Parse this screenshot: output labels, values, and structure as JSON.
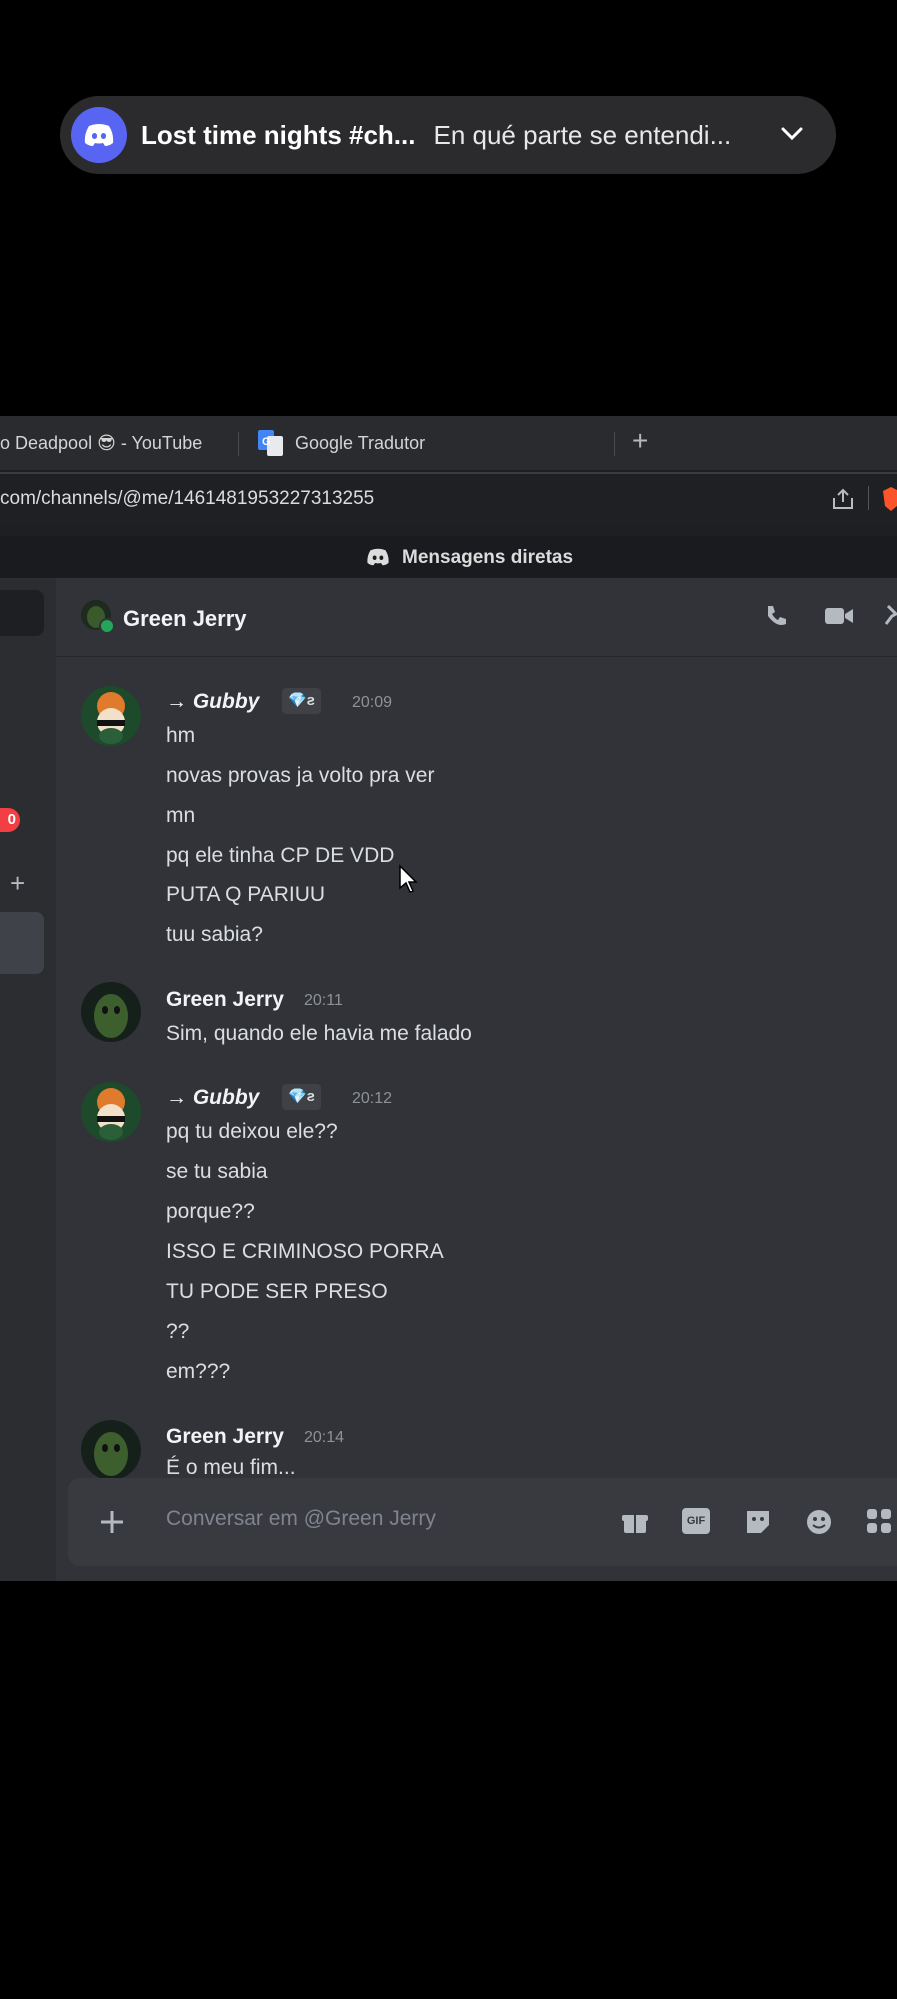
{
  "notification": {
    "app_icon": "discord-icon",
    "title": "Lost time nights #ch...",
    "preview": "En qué parte se entendi...",
    "expand_icon": "chevron-down-icon"
  },
  "browser": {
    "tabs": [
      {
        "label": "o Deadpool 😎 - YouTube"
      },
      {
        "label": "Google Tradutor",
        "icon": "google-translate-icon"
      }
    ],
    "new_tab_label": "+",
    "url": "com/channels/@me/1461481953227313255",
    "page_title": "Mensagens diretas"
  },
  "sidebar": {
    "badge": "0",
    "add_label": "+"
  },
  "chat": {
    "recipient": "Green Jerry",
    "messages": [
      {
        "author": "→ Gubby",
        "tag": "💎ƨ",
        "time": "20:09",
        "lines": [
          "hm",
          "novas provas ja volto pra ver",
          "mn",
          "pq ele tinha CP DE VDD",
          "PUTA Q PARIUU",
          "tuu sabia?"
        ]
      },
      {
        "author": "Green Jerry",
        "time": "20:11",
        "lines": [
          "Sim, quando ele havia me falado"
        ]
      },
      {
        "author": "→ Gubby",
        "tag": "💎ƨ",
        "time": "20:12",
        "lines": [
          "pq tu deixou ele??",
          "se tu sabia",
          "porque??",
          "ISSO E CRIMINOSO PORRA",
          "TU PODE SER PRESO",
          "??",
          "em???"
        ]
      },
      {
        "author": "Green Jerry",
        "time": "20:14",
        "lines": [
          "É o meu fim..."
        ]
      }
    ],
    "composer_placeholder": "Conversar em @Green Jerry",
    "gif_label": "GIF"
  },
  "colors": {
    "discord_blurple": "#5865f2",
    "chat_bg": "#313338",
    "sidebar_bg": "#2b2d31",
    "online_green": "#23a55a",
    "badge_red": "#f23f43"
  }
}
